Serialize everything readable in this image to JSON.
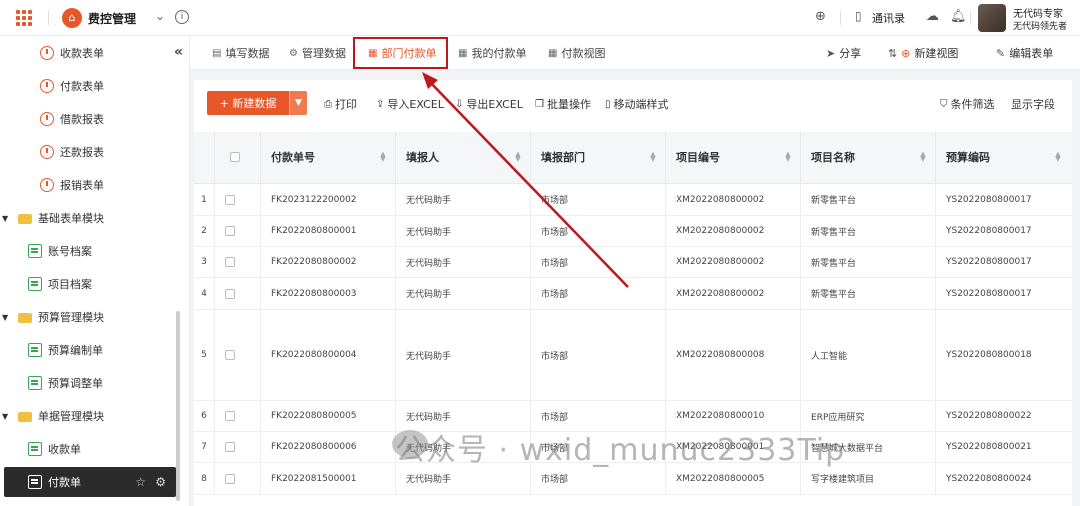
{
  "topbar": {
    "app_name": "费控管理",
    "logo_glyph": "⌂",
    "contacts_label": "通讯录",
    "user_name": "无代码专家",
    "user_org": "无代码领先者"
  },
  "sidebar": {
    "items": [
      {
        "label": "收款表单",
        "icon": "clock-icon",
        "kind": "form"
      },
      {
        "label": "付款表单",
        "icon": "clock-icon",
        "kind": "form"
      },
      {
        "label": "借款报表",
        "icon": "clock-icon",
        "kind": "form"
      },
      {
        "label": "还款报表",
        "icon": "clock-icon",
        "kind": "form"
      },
      {
        "label": "报销表单",
        "icon": "clock-icon",
        "kind": "form"
      },
      {
        "label": "基础表单模块",
        "icon": "folder-icon",
        "kind": "group"
      },
      {
        "label": "账号档案",
        "icon": "document-icon",
        "kind": "doc"
      },
      {
        "label": "项目档案",
        "icon": "document-icon",
        "kind": "doc"
      },
      {
        "label": "预算管理模块",
        "icon": "folder-icon",
        "kind": "group"
      },
      {
        "label": "预算编制单",
        "icon": "document-icon",
        "kind": "doc"
      },
      {
        "label": "预算调整单",
        "icon": "document-icon",
        "kind": "doc"
      },
      {
        "label": "单据管理模块",
        "icon": "folder-icon",
        "kind": "group"
      },
      {
        "label": "收款单",
        "icon": "document-icon",
        "kind": "doc"
      },
      {
        "label": "付款单",
        "icon": "document-icon",
        "kind": "doc",
        "active": true
      }
    ]
  },
  "tabs": [
    {
      "label": "填写数据",
      "icon": "edit-form-icon"
    },
    {
      "label": "管理数据",
      "icon": "gear-icon"
    },
    {
      "label": "部门付款单",
      "icon": "table-icon",
      "active": true
    },
    {
      "label": "我的付款单",
      "icon": "table-icon"
    },
    {
      "label": "付款视图",
      "icon": "table-icon"
    }
  ],
  "tab_actions": {
    "share": "分享",
    "new_view": "新建视图",
    "edit_form": "编辑表单"
  },
  "toolbar": {
    "new_data": "+ 新建数据",
    "print": "打印",
    "import": "导入EXCEL",
    "export": "导出EXCEL",
    "batch": "批量操作",
    "mobile": "移动端样式",
    "filter": "条件筛选",
    "fields": "显示字段"
  },
  "table": {
    "columns": [
      "付款单号",
      "填报人",
      "填报部门",
      "项目编号",
      "项目名称",
      "预算编码"
    ],
    "rows": [
      {
        "no": "1",
        "cells": [
          "FK2023122200002",
          "无代码助手",
          "市场部",
          "XM2022080800002",
          "新零售平台",
          "YS2022080800017"
        ]
      },
      {
        "no": "2",
        "cells": [
          "FK2022080800001",
          "无代码助手",
          "市场部",
          "XM2022080800002",
          "新零售平台",
          "YS2022080800017"
        ]
      },
      {
        "no": "3",
        "cells": [
          "FK2022080800002",
          "无代码助手",
          "市场部",
          "XM2022080800002",
          "新零售平台",
          "YS2022080800017"
        ]
      },
      {
        "no": "4",
        "cells": [
          "FK2022080800003",
          "无代码助手",
          "市场部",
          "XM2022080800002",
          "新零售平台",
          "YS2022080800017"
        ]
      },
      {
        "no": "5",
        "cells": [
          "FK2022080800004",
          "无代码助手",
          "市场部",
          "XM2022080800008",
          "人工智能",
          "YS2022080800018"
        ]
      },
      {
        "no": "6",
        "cells": [
          "FK2022080800005",
          "无代码助手",
          "市场部",
          "XM2022080800010",
          "ERP应用研究",
          "YS2022080800022"
        ]
      },
      {
        "no": "7",
        "cells": [
          "FK2022080800006",
          "无代码助手",
          "市场部",
          "XM2022080800001",
          "智慧城大数据平台",
          "YS2022080800021"
        ]
      },
      {
        "no": "8",
        "cells": [
          "FK2022081500001",
          "无代码助手",
          "市场部",
          "XM2022080800005",
          "写字楼建筑项目",
          "YS2022080800024"
        ]
      }
    ]
  },
  "watermark": "公众号 · wxid_munuc2333Tip",
  "colors": {
    "accent": "#e8572a",
    "highlight": "#c0161e"
  }
}
